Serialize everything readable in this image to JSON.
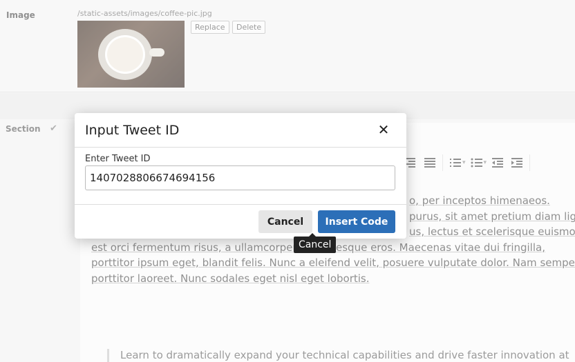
{
  "background": {
    "image_field": {
      "label": "Image",
      "path": "/static-assets/images/coffee-pic.jpg",
      "replace_label": "Replace",
      "delete_label": "Delete"
    },
    "section_label": "Section",
    "body_lines": [
      "o, per inceptos himenaeos.",
      "purus, sit amet pretium diam ligul",
      "us, lectus et scelerisque euismod",
      "est orci fermentum risus, a ullamcorper      pellentesque eros. Maecenas vitae dui fringilla,",
      "porttitor ipsum eget, blandit felis. Nunc a eleifend velit, posuere vulputate dolor. Nam semper",
      "porttitor laoreet. Nunc sodales eget nisl eget lobortis."
    ],
    "quote_text": "Learn to dramatically expand your technical capabilities and drive faster innovation at"
  },
  "modal": {
    "title": "Input Tweet ID",
    "field_label": "Enter Tweet ID",
    "tweet_id": "1407028806674694156",
    "cancel_label": "Cancel",
    "insert_label": "Insert Code"
  },
  "tooltip": {
    "text": "Cancel"
  },
  "colors": {
    "primary": "#2c6fb8",
    "overlay": "rgba(255,255,255,0.35)"
  }
}
